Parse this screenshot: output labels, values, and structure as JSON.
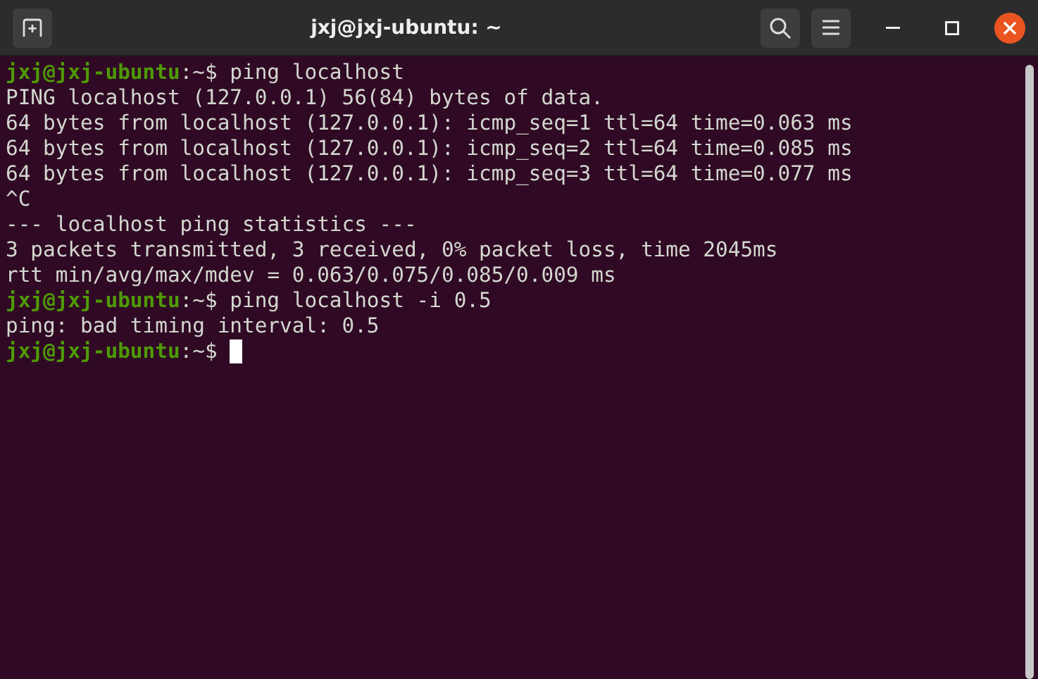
{
  "window": {
    "title": "jxj@jxj-ubuntu: ~"
  },
  "terminal": {
    "lines": [
      {
        "kind": "prompt",
        "user_host": "jxj@jxj-ubuntu",
        "path": ":~$",
        "command": "ping localhost",
        "cursor": false
      },
      {
        "kind": "output",
        "text": "PING localhost (127.0.0.1) 56(84) bytes of data."
      },
      {
        "kind": "output",
        "text": "64 bytes from localhost (127.0.0.1): icmp_seq=1 ttl=64 time=0.063 ms"
      },
      {
        "kind": "output",
        "text": "64 bytes from localhost (127.0.0.1): icmp_seq=2 ttl=64 time=0.085 ms"
      },
      {
        "kind": "output",
        "text": "64 bytes from localhost (127.0.0.1): icmp_seq=3 ttl=64 time=0.077 ms"
      },
      {
        "kind": "output",
        "text": "^C"
      },
      {
        "kind": "output",
        "text": "--- localhost ping statistics ---"
      },
      {
        "kind": "output",
        "text": "3 packets transmitted, 3 received, 0% packet loss, time 2045ms"
      },
      {
        "kind": "output",
        "text": "rtt min/avg/max/mdev = 0.063/0.075/0.085/0.009 ms"
      },
      {
        "kind": "prompt",
        "user_host": "jxj@jxj-ubuntu",
        "path": ":~$",
        "command": "ping localhost -i 0.5",
        "cursor": false
      },
      {
        "kind": "output",
        "text": "ping: bad timing interval: 0.5"
      },
      {
        "kind": "prompt",
        "user_host": "jxj@jxj-ubuntu",
        "path": ":~$",
        "cursor": true
      }
    ]
  }
}
